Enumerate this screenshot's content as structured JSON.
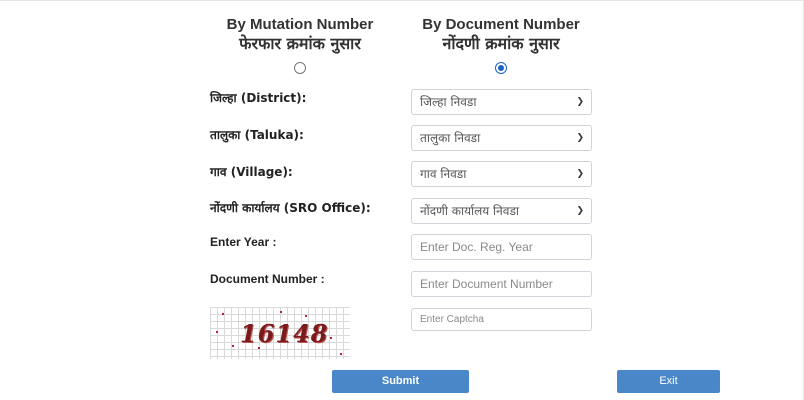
{
  "search_options": {
    "mutation": {
      "title_en": "By Mutation Number",
      "title_mr": "फेरफार क्रमांक नुसार",
      "selected": false
    },
    "document": {
      "title_en": "By Document Number",
      "title_mr": "नोंदणी क्रमांक नुसार",
      "selected": true
    }
  },
  "form": {
    "district": {
      "label": "जिल्हा (District):",
      "value": "जिल्हा निवडा"
    },
    "taluka": {
      "label": "तालुका (Taluka):",
      "value": "तालुका निवडा"
    },
    "village": {
      "label": "गाव (Village):",
      "value": "गाव निवडा"
    },
    "sro_office": {
      "label": "नोंदणी कार्यालय (SRO Office):",
      "value": "नोंदणी कार्यालय निवडा"
    },
    "year": {
      "label": "Enter Year :",
      "placeholder": "Enter Doc. Reg. Year"
    },
    "document_number": {
      "label": "Document Number :",
      "placeholder": "Enter Document Number"
    },
    "captcha": {
      "code": "16148",
      "placeholder": "Enter Captcha"
    }
  },
  "buttons": {
    "submit": "Submit",
    "exit": "Exit"
  },
  "colors": {
    "accent": "#4a87c8",
    "radio_selected": "#1a62c4",
    "captcha_text": "#7a1a1a"
  }
}
